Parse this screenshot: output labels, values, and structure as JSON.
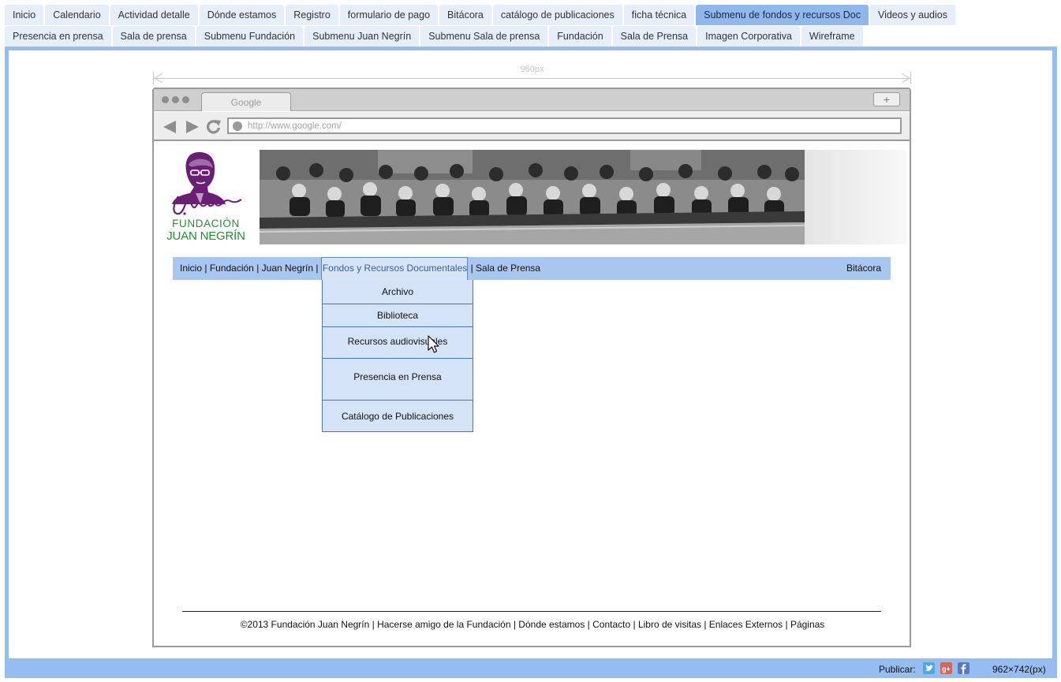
{
  "page_tabs": {
    "row1": [
      "Inicio",
      "Calendario",
      "Actividad detalle",
      "Dónde estamos",
      "Registro",
      "formulario de pago",
      "Bitácora",
      "catálogo de publicaciones",
      "ficha técnica",
      "Submenu de fondos y recursos Doc",
      "Videos y audios"
    ],
    "row2": [
      "Presencia en prensa",
      "Sala de prensa",
      "Submenu Fundación",
      "Submenu Juan Negrín",
      "Submenu Sala de prensa",
      "Fundación",
      "Sala de Prensa",
      "Imagen Corporativa",
      "Wireframe"
    ],
    "active": "Submenu de fondos y recursos Doc"
  },
  "ruler": {
    "label": "960px"
  },
  "browser": {
    "tab_title": "Google",
    "new_tab_symbol": "+",
    "url": "http://www.google.com/"
  },
  "site": {
    "logo": {
      "line1": "FUNDACIÓN",
      "line2": "JUAN NEGRÍN",
      "signature": "J. Negrín"
    },
    "nav": {
      "items": [
        "Inicio",
        "Fundación",
        "Juan Negrín",
        "Fondos y Recursos Documentales",
        "Sala de Prensa"
      ],
      "separator": " | ",
      "right": "Bitácora"
    },
    "dropdown": [
      "Archivo",
      "Biblioteca",
      "Recursos audiovisuales",
      "Presencia en Prensa",
      "Catálogo de Publicaciones"
    ],
    "footer": "©2013 Fundación Juan Negrín | Hacerse amigo de la Fundación | Dónde estamos | Contacto | Libro de visitas | Enlaces Externos | Páginas"
  },
  "status_bar": {
    "share_label": "Publicar:",
    "social_icons": [
      "twitter-icon",
      "google-plus-icon",
      "facebook-icon"
    ],
    "dimensions": "962×742(px)"
  },
  "colors": {
    "frame_blue": "#95bdef",
    "active_tab": "#8fb7ec",
    "nav_bar": "#a9c6ee",
    "dropdown_bg": "#d5e3f6",
    "logo_green": "#1f8f2c",
    "logo_purple": "#6b1f74"
  }
}
